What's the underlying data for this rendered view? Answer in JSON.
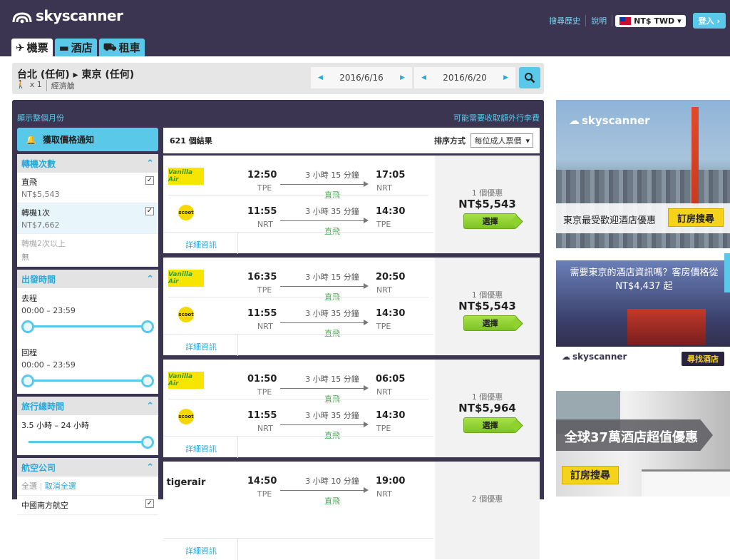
{
  "header": {
    "brand": "skyscanner",
    "links": [
      "搜尋歷史",
      "說明"
    ],
    "currency": "NT$ TWD",
    "login": "登入"
  },
  "tabs": [
    {
      "label": "機票",
      "icon": "plane-icon",
      "active": true
    },
    {
      "label": "酒店",
      "icon": "bed-icon",
      "active": false
    },
    {
      "label": "租車",
      "icon": "car-icon",
      "active": false
    }
  ],
  "search": {
    "route": "台北 (任何) ▸ 東京 (任何)",
    "passengers": "x 1",
    "cabin": "經濟艙",
    "depart_date": "2016/6/16",
    "return_date": "2016/6/20"
  },
  "panel": {
    "show_month": "顯示整個月份",
    "bag_fee": "可能需要收取額外行李費"
  },
  "sidebar": {
    "alert_button": "獲取價格通知",
    "stops": {
      "title": "轉機次數",
      "options": [
        {
          "label": "直飛",
          "price": "NT$5,543",
          "checked": true
        },
        {
          "label": "轉機1次",
          "price": "NT$7,662",
          "checked": true
        },
        {
          "label": "轉機2次以上",
          "price": "無",
          "checked": false
        }
      ]
    },
    "times": {
      "title": "出發時間",
      "outbound_label": "去程",
      "outbound_range": "00:00 – 23:59",
      "return_label": "回程",
      "return_range": "00:00 – 23:59"
    },
    "duration": {
      "title": "旅行總時間",
      "range": "3.5 小時 – 24 小時"
    },
    "airlines": {
      "title": "航空公司",
      "select_all": "全選",
      "clear_all": "取消全選",
      "items": [
        {
          "label": "中國南方航空",
          "checked": true
        }
      ]
    }
  },
  "results": {
    "count": "621 個結果",
    "sort_label": "排序方式",
    "sort_value": "每位成人票價",
    "details_label": "詳細資訊",
    "select_label": "選擇",
    "cards": [
      {
        "legs": [
          {
            "airline": "Vanilla Air",
            "dep": "12:50",
            "dep_code": "TPE",
            "duration": "3 小時 15 分鐘",
            "stops": "直飛",
            "arr": "17:05",
            "arr_code": "NRT"
          },
          {
            "airline": "scoot",
            "dep": "11:55",
            "dep_code": "NRT",
            "duration": "3 小時 35 分鐘",
            "stops": "直飛",
            "arr": "14:30",
            "arr_code": "TPE"
          }
        ],
        "deals": "1 個優惠",
        "price": "NT$5,543"
      },
      {
        "legs": [
          {
            "airline": "Vanilla Air",
            "dep": "16:35",
            "dep_code": "TPE",
            "duration": "3 小時 15 分鐘",
            "stops": "直飛",
            "arr": "20:50",
            "arr_code": "NRT"
          },
          {
            "airline": "scoot",
            "dep": "11:55",
            "dep_code": "NRT",
            "duration": "3 小時 35 分鐘",
            "stops": "直飛",
            "arr": "14:30",
            "arr_code": "TPE"
          }
        ],
        "deals": "1 個優惠",
        "price": "NT$5,543"
      },
      {
        "legs": [
          {
            "airline": "Vanilla Air",
            "dep": "01:50",
            "dep_code": "TPE",
            "duration": "3 小時 15 分鐘",
            "stops": "直飛",
            "arr": "06:05",
            "arr_code": "NRT"
          },
          {
            "airline": "scoot",
            "dep": "11:55",
            "dep_code": "NRT",
            "duration": "3 小時 35 分鐘",
            "stops": "直飛",
            "arr": "14:30",
            "arr_code": "TPE"
          }
        ],
        "deals": "1 個優惠",
        "price": "NT$5,964"
      },
      {
        "legs": [
          {
            "airline": "tigerair",
            "dep": "14:50",
            "dep_code": "TPE",
            "duration": "3 小時 10 分鐘",
            "stops": "直飛",
            "arr": "19:00",
            "arr_code": "NRT"
          }
        ],
        "deals": "2 個優惠",
        "price": ""
      }
    ]
  },
  "ads": {
    "ad1_brand": "skyscanner",
    "ad1_text": "東京最受歡迎酒店優惠",
    "ad1_button": "訂房搜尋",
    "ad2_text": "需要東京的酒店資訊嗎？客房價格從 NT$4,437 起",
    "ad2_brand": "skyscanner",
    "ad2_button": "尋找酒店",
    "ad3_text": "全球37萬酒店超值優惠",
    "ad3_button": "訂房搜尋"
  },
  "colors": {
    "header_bg": "#3b3551",
    "accent": "#5ac8e8",
    "direct_green": "#4caf50",
    "select_green": "#8ed22d"
  }
}
